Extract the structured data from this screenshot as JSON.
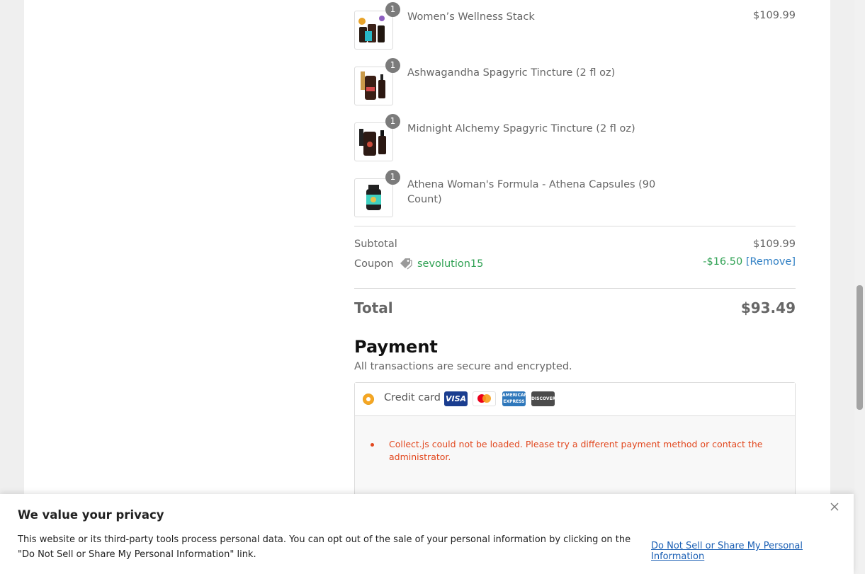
{
  "order": {
    "items": [
      {
        "name": "Women’s Wellness Stack",
        "qty": "1",
        "price": "$109.99"
      },
      {
        "name": "Ashwagandha Spagyric Tincture (2 fl oz)",
        "qty": "1",
        "price": ""
      },
      {
        "name": "Midnight Alchemy Spagyric Tincture (2 fl oz)",
        "qty": "1",
        "price": ""
      },
      {
        "name": "Athena Woman's Formula - Athena Capsules (90 Count)",
        "qty": "1",
        "price": ""
      }
    ],
    "subtotal_label": "Subtotal",
    "subtotal_value": "$109.99",
    "coupon_label": "Coupon",
    "coupon_code": "sevolution15",
    "coupon_discount": "-$16.50",
    "coupon_remove": "[Remove]",
    "total_label": "Total",
    "total_value": "$93.49"
  },
  "payment": {
    "title": "Payment",
    "subtitle": "All transactions are secure and encrypted.",
    "method_label": "Credit card",
    "cards": [
      "VISA",
      "mastercard",
      "AMERICAN EXPRESS",
      "DISCOVER"
    ],
    "error": "Collect.js could not be loaded. Please try a different payment method or contact the administrator."
  },
  "privacy": {
    "title": "We value your privacy",
    "text": "This website or its third-party tools process personal data. You can opt out of the sale of your personal information by clicking on the \"Do Not Sell or Share My Personal Information\" link.",
    "link": "Do Not Sell or Share My Personal Information"
  },
  "colors": {
    "accent_green": "#2fa153",
    "link_blue": "#2f7fc4",
    "error_red": "#e2481f",
    "radio_orange": "#f6a623"
  }
}
